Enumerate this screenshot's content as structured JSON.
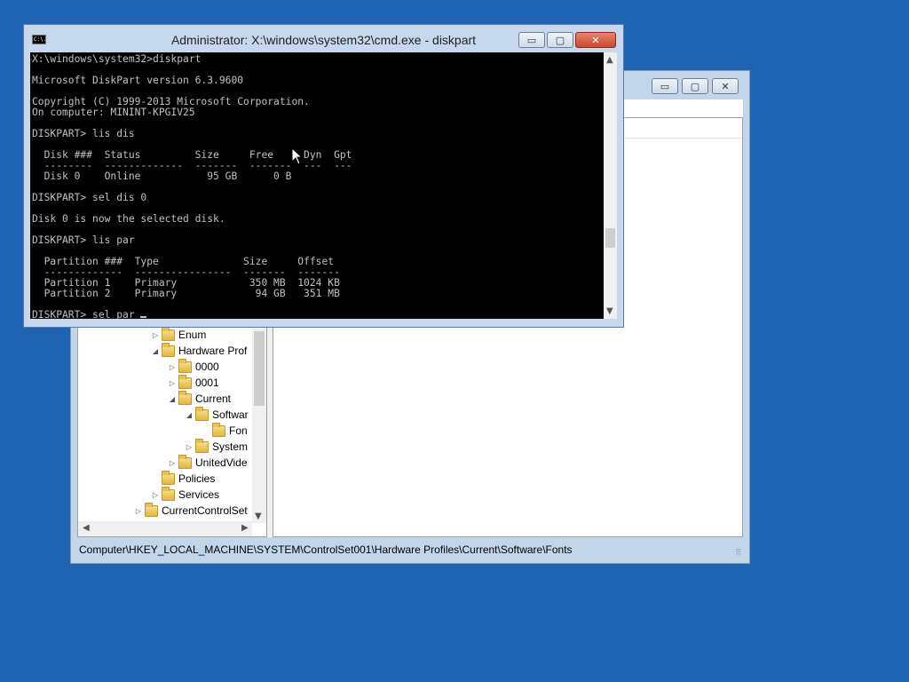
{
  "registry_editor": {
    "caption_buttons": {
      "minimize": "▭",
      "maximize": "▢",
      "close": "✕"
    },
    "tree": [
      {
        "label": "Enum",
        "expander": "▷"
      },
      {
        "label": "Hardware Prof",
        "expander": "◢"
      },
      {
        "label": "0000",
        "expander": "▷"
      },
      {
        "label": "0001",
        "expander": "▷"
      },
      {
        "label": "Current",
        "expander": "◢"
      },
      {
        "label": "Softwar",
        "expander": "◢"
      },
      {
        "label": "Fon",
        "expander": ""
      },
      {
        "label": "System",
        "expander": "▷"
      },
      {
        "label": "UnitedVide",
        "expander": "▷"
      },
      {
        "label": "Policies",
        "expander": ""
      },
      {
        "label": "Services",
        "expander": "▷"
      },
      {
        "label": "CurrentControlSet",
        "expander": "▷"
      }
    ],
    "status_path": "Computer\\HKEY_LOCAL_MACHINE\\SYSTEM\\ControlSet001\\Hardware Profiles\\Current\\Software\\Fonts"
  },
  "cmd": {
    "title": "Administrator: X:\\windows\\system32\\cmd.exe - diskpart",
    "icon_text": "C:\\.",
    "caption_buttons": {
      "minimize": "▭",
      "maximize": "▢",
      "close": "✕"
    },
    "console_text": "X:\\windows\\system32>diskpart\n\nMicrosoft DiskPart version 6.3.9600\n\nCopyright (C) 1999-2013 Microsoft Corporation.\nOn computer: MININT-KPGIV25\n\nDISKPART> lis dis\n\n  Disk ###  Status         Size     Free     Dyn  Gpt\n  --------  -------------  -------  -------  ---  ---\n  Disk 0    Online           95 GB      0 B\n\nDISKPART> sel dis 0\n\nDisk 0 is now the selected disk.\n\nDISKPART> lis par\n\n  Partition ###  Type              Size     Offset\n  -------------  ----------------  -------  -------\n  Partition 1    Primary            350 MB  1024 KB\n  Partition 2    Primary             94 GB   351 MB\n\nDISKPART> sel par "
  },
  "colors": {
    "desktop": "#1f63b3",
    "console_bg": "#000000",
    "console_fg": "#c0c0c0",
    "close_button": "#c64a31"
  }
}
